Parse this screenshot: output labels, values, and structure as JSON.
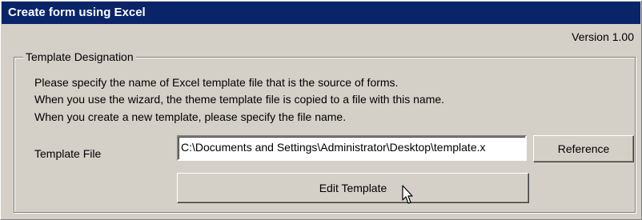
{
  "window": {
    "title": "Create form using Excel"
  },
  "version": "Version 1.00",
  "template_group": {
    "label": "Template Designation",
    "description": [
      "Please specify the name of Excel template file that is the source of forms.",
      "When you use the wizard, the theme template file is copied to a file with this name.",
      "When you create a new template, please specify the file name."
    ],
    "template_file_label": "Template File",
    "template_file_value": "C:\\Documents and Settings\\Administrator\\Desktop\\template.x",
    "reference_button": "Reference",
    "edit_button": "Edit Template"
  },
  "colors": {
    "titlebar": "#0a246a",
    "face": "#d4d0c8"
  },
  "icons": {
    "cursor": "arrow-cursor-icon"
  }
}
